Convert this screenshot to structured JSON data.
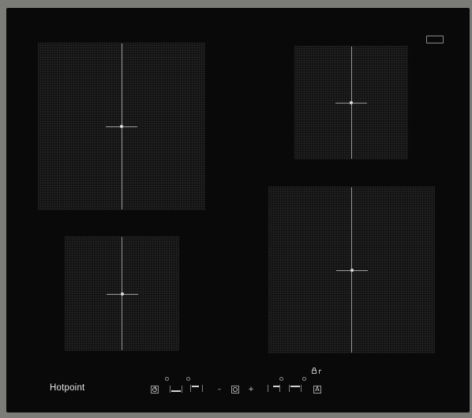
{
  "brand": {
    "name": "Hotpoint"
  },
  "zones": [
    {
      "id": "front-left"
    },
    {
      "id": "rear-right"
    },
    {
      "id": "rear-left"
    },
    {
      "id": "front-right"
    }
  ],
  "controls": {
    "minus_label": "–",
    "plus_label": "+",
    "auto_label": "A"
  },
  "icons": {
    "power": "power-icon",
    "timer": "timer-icon",
    "lock": "lock-icon",
    "auto": "auto-icon"
  },
  "colors": {
    "glass": "#090909",
    "frame": "#7b7b77",
    "zone_lines": "#9a9a9a",
    "text": "#e6e6e6"
  }
}
